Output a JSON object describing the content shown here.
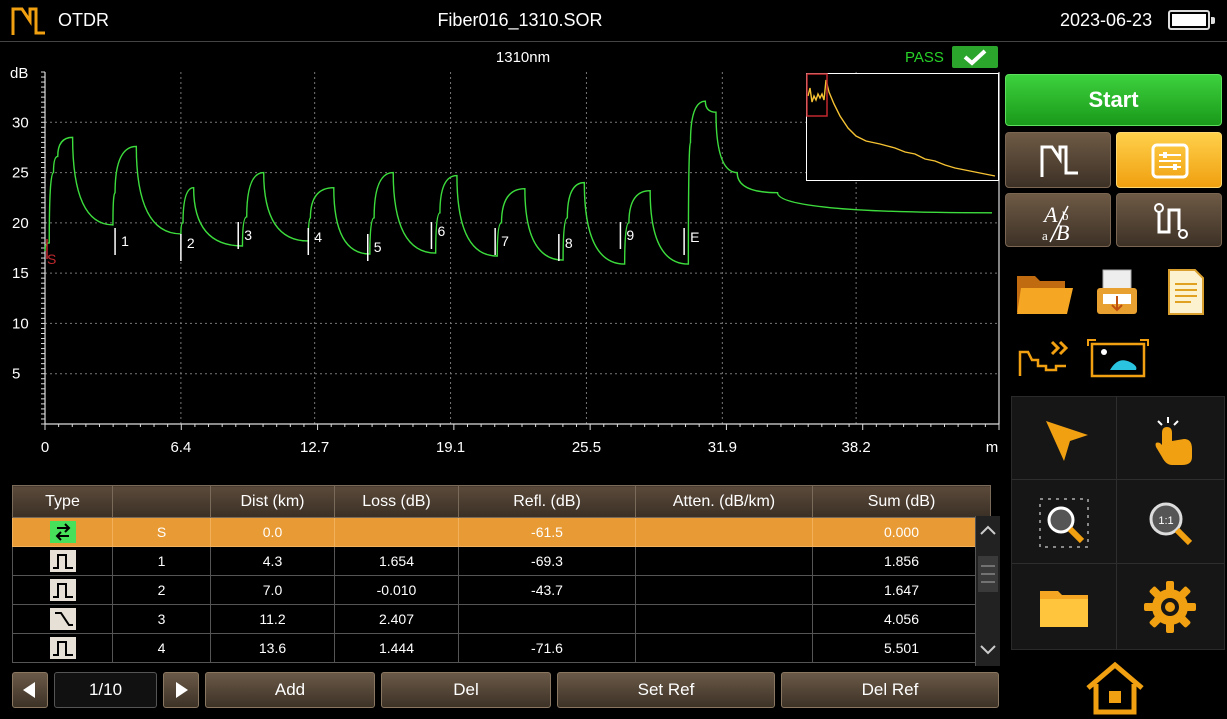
{
  "header": {
    "app_title": "OTDR",
    "file_name": "Fiber016_1310.SOR",
    "date": "2023-06-23",
    "logo_icon": "otdr-logo-icon",
    "battery_icon": "battery-full-icon"
  },
  "chart": {
    "wavelength_label": "1310nm",
    "status_label": "PASS",
    "status_color": "#27d127",
    "y_unit": "dB",
    "x_unit": "m",
    "trace_color": "#3ddc3d"
  },
  "chart_data": {
    "type": "line",
    "title": "1310nm",
    "ylabel": "dB",
    "xlabel": "m",
    "ylim": [
      0,
      35
    ],
    "xlim": [
      0,
      44.6
    ],
    "x_ticks": [
      "0",
      "6.4",
      "12.7",
      "19.1",
      "25.5",
      "31.9",
      "38.2",
      "m"
    ],
    "y_ticks": [
      "dB",
      "30",
      "25",
      "20",
      "15",
      "10",
      "5"
    ],
    "grid": true,
    "series": [
      {
        "x": [
          0,
          0.2,
          0.4,
          0.6,
          1.3,
          3.2,
          3.3,
          4.3,
          6.4,
          6.5,
          7.0,
          9.3,
          9.5,
          10.3,
          12.4,
          12.5,
          13.6,
          15.3,
          15.5,
          16.4,
          18.4,
          18.6,
          19.4,
          21.3,
          21.5,
          22.6,
          24.4,
          24.6,
          25.4,
          27.3,
          27.5,
          28.5,
          30.3,
          30.4,
          31.1,
          31.6,
          32.6,
          34.5,
          44.6
        ],
        "y": [
          17.2,
          18.0,
          25.0,
          26.6,
          28.5,
          19.8,
          23.0,
          27.6,
          18.9,
          20.0,
          23.5,
          17.7,
          20.6,
          25.0,
          18.2,
          20.5,
          23.5,
          16.9,
          20.5,
          25.0,
          17.0,
          21.0,
          24.7,
          16.7,
          20.0,
          23.4,
          16.3,
          20.5,
          24.0,
          15.9,
          20.0,
          23.2,
          15.9,
          28.0,
          32.1,
          31.0,
          25.0,
          23.0,
          21.0
        ]
      }
    ],
    "events": [
      {
        "label": "S",
        "x": 0.0
      },
      {
        "label": "1",
        "x": 3.3
      },
      {
        "label": "2",
        "x": 6.4
      },
      {
        "label": "3",
        "x": 9.1
      },
      {
        "label": "4",
        "x": 12.4
      },
      {
        "label": "5",
        "x": 15.2
      },
      {
        "label": "6",
        "x": 18.2
      },
      {
        "label": "7",
        "x": 21.2
      },
      {
        "label": "8",
        "x": 24.2
      },
      {
        "label": "9",
        "x": 27.1
      },
      {
        "label": "E",
        "x": 30.1
      }
    ]
  },
  "table": {
    "headers": [
      "Type",
      "",
      "Dist (km)",
      "Loss (dB)",
      "Refl. (dB)",
      "Atten. (dB/km)",
      "Sum (dB)"
    ],
    "rows": [
      {
        "type_icon": "start-event-icon",
        "event": "S",
        "dist": "0.0",
        "loss": "",
        "refl": "-61.5",
        "atten": "",
        "sum": "0.000"
      },
      {
        "type_icon": "reflective-event-icon",
        "event": "1",
        "dist": "4.3",
        "loss": "1.654",
        "refl": "-69.3",
        "atten": "",
        "sum": "1.856"
      },
      {
        "type_icon": "reflective-event-icon",
        "event": "2",
        "dist": "7.0",
        "loss": "-0.010",
        "refl": "-43.7",
        "atten": "",
        "sum": "1.647"
      },
      {
        "type_icon": "non-reflective-event-icon",
        "event": "3",
        "dist": "11.2",
        "loss": "2.407",
        "refl": "",
        "atten": "",
        "sum": "4.056"
      },
      {
        "type_icon": "reflective-event-icon",
        "event": "4",
        "dist": "13.6",
        "loss": "1.444",
        "refl": "-71.6",
        "atten": "",
        "sum": "5.501"
      }
    ]
  },
  "pager": {
    "label": "1/10"
  },
  "buttons": {
    "start": "Start",
    "add": "Add",
    "del": "Del",
    "set_ref": "Set Ref",
    "del_ref": "Del Ref"
  },
  "colors": {
    "accent": "#f0a010",
    "selected_row": "#e89b34",
    "start_button": "#2ec02e"
  }
}
